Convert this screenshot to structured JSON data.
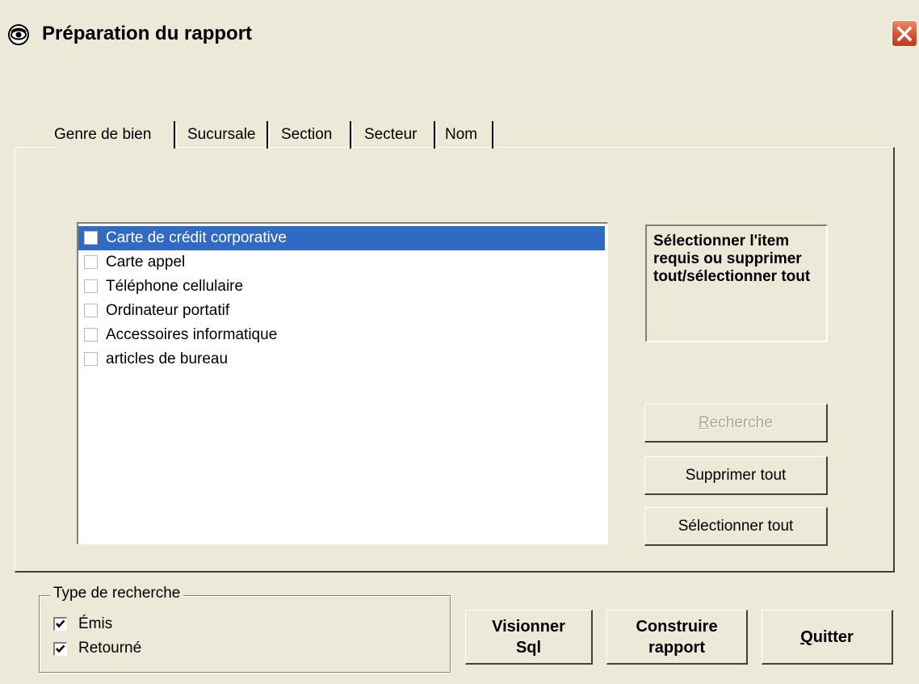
{
  "window": {
    "title": "Préparation du rapport"
  },
  "tabs": [
    {
      "label": "Genre de bien",
      "active": true
    },
    {
      "label": "Sucursale",
      "active": false
    },
    {
      "label": "Section",
      "active": false
    },
    {
      "label": "Secteur",
      "active": false
    },
    {
      "label": "Nom",
      "active": false
    }
  ],
  "list": {
    "items": [
      {
        "label": "Carte de crédit corporative",
        "checked": false,
        "selected": true
      },
      {
        "label": "Carte appel",
        "checked": false,
        "selected": false
      },
      {
        "label": "Téléphone cellulaire",
        "checked": false,
        "selected": false
      },
      {
        "label": "Ordinateur portatif",
        "checked": false,
        "selected": false
      },
      {
        "label": "Accessoires informatique",
        "checked": false,
        "selected": false
      },
      {
        "label": "articles de bureau",
        "checked": false,
        "selected": false
      }
    ]
  },
  "info_text": "Sélectionner l'item requis ou supprimer tout/sélectionner tout",
  "side_buttons": {
    "search": "Recherche",
    "delete_all": "Supprimer tout",
    "select_all": "Sélectionner tout"
  },
  "search_type": {
    "title": "Type de recherche",
    "options": [
      {
        "label": "Émis",
        "checked": true
      },
      {
        "label": "Retourné",
        "checked": true
      }
    ]
  },
  "bottom_buttons": {
    "view_sql_line1": "Visionner",
    "view_sql_line2": "Sql",
    "build_line1": "Construire",
    "build_line2": "rapport",
    "quit": "Quitter"
  },
  "colors": {
    "background": "#ece9d8",
    "selection": "#316ac5",
    "close_button": "#d3502c"
  },
  "icons": [
    "eye-icon",
    "close-icon",
    "checkmark-icon"
  ]
}
